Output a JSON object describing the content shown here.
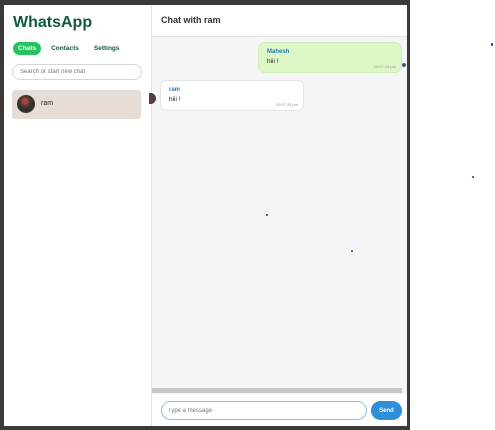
{
  "sidebar": {
    "app_title": "WhatsApp",
    "tabs": [
      {
        "label": "Chats",
        "active": true
      },
      {
        "label": "Contacts",
        "active": false
      },
      {
        "label": "Settings",
        "active": false
      }
    ],
    "search_placeholder": "Search or start new chat",
    "chats": [
      {
        "name": "ram"
      }
    ]
  },
  "chat": {
    "title": "Chat with ram",
    "messages": [
      {
        "sender": "Mahesh",
        "text": "hiii !",
        "time": "10:07:14 pm",
        "direction": "outgoing"
      },
      {
        "sender": "ram",
        "text": "hiii !",
        "time": "10:07:25 pm",
        "direction": "incoming"
      }
    ],
    "composer": {
      "placeholder": "Type a message",
      "value": "",
      "send_label": "Send"
    }
  },
  "colors": {
    "brand": "#0f5a44",
    "active_tab": "#25c35f",
    "outgoing_bubble": "#dcf8c6",
    "send_button": "#2f8fd8"
  }
}
